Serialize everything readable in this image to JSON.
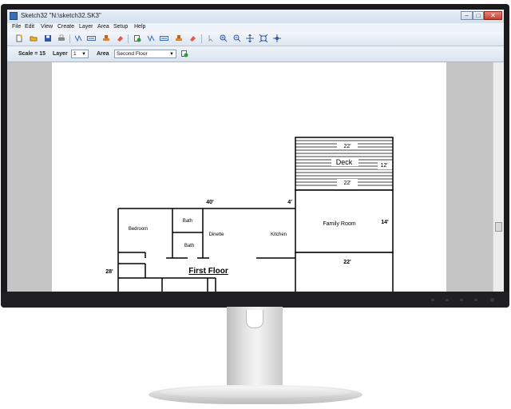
{
  "window": {
    "title": "Sketch32 \"N:\\sketch32.SK3\"",
    "controls": {
      "minimize": "–",
      "maximize": "□",
      "close": "✕"
    }
  },
  "menu": [
    {
      "key": "file",
      "label": "File"
    },
    {
      "key": "edit",
      "label": "Edit"
    },
    {
      "key": "view",
      "label": "View"
    },
    {
      "key": "create",
      "label": "Create"
    },
    {
      "key": "layer",
      "label": "Layer"
    },
    {
      "key": "area",
      "label": "Area"
    },
    {
      "key": "setup",
      "label": "Setup"
    },
    {
      "key": "help",
      "label": "Help"
    }
  ],
  "toolbar": {
    "icons": [
      "new-file-icon",
      "open-folder-icon",
      "save-icon",
      "print-icon",
      "draw-line-icon",
      "draw-polygon-icon",
      "stamp-icon",
      "eraser-icon",
      "add-area-icon",
      "draw-line-2-icon",
      "draw-polygon-2-icon",
      "stamp-2-icon",
      "eraser-2-icon",
      "pointer-icon",
      "zoom-in-icon",
      "zoom-out-icon",
      "fit-window-icon",
      "zoom-extents-icon",
      "pan-icon"
    ]
  },
  "options": {
    "scale_label": "Scale = 15",
    "layer_label": "Layer",
    "layer_value": "1",
    "area_label": "Area",
    "area_value": "Second Floor"
  },
  "plan": {
    "deck_label": "Deck",
    "deck_top_dim": "22'",
    "deck_side_dim": "12'",
    "deck_bottom_dim": "22'",
    "house_width_dim": "40'",
    "jog_dim": "4'",
    "family_room_label": "Family Room",
    "family_room_dim": "14'",
    "lower_room_dim": "22'",
    "left_height_dim": "28'",
    "bedroom_label": "Bedroom",
    "bath1_label": "Bath",
    "bath2_label": "Bath",
    "dinette_label": "Dinette",
    "kitchen_label": "Kitchen",
    "floor_title": "First Floor"
  }
}
